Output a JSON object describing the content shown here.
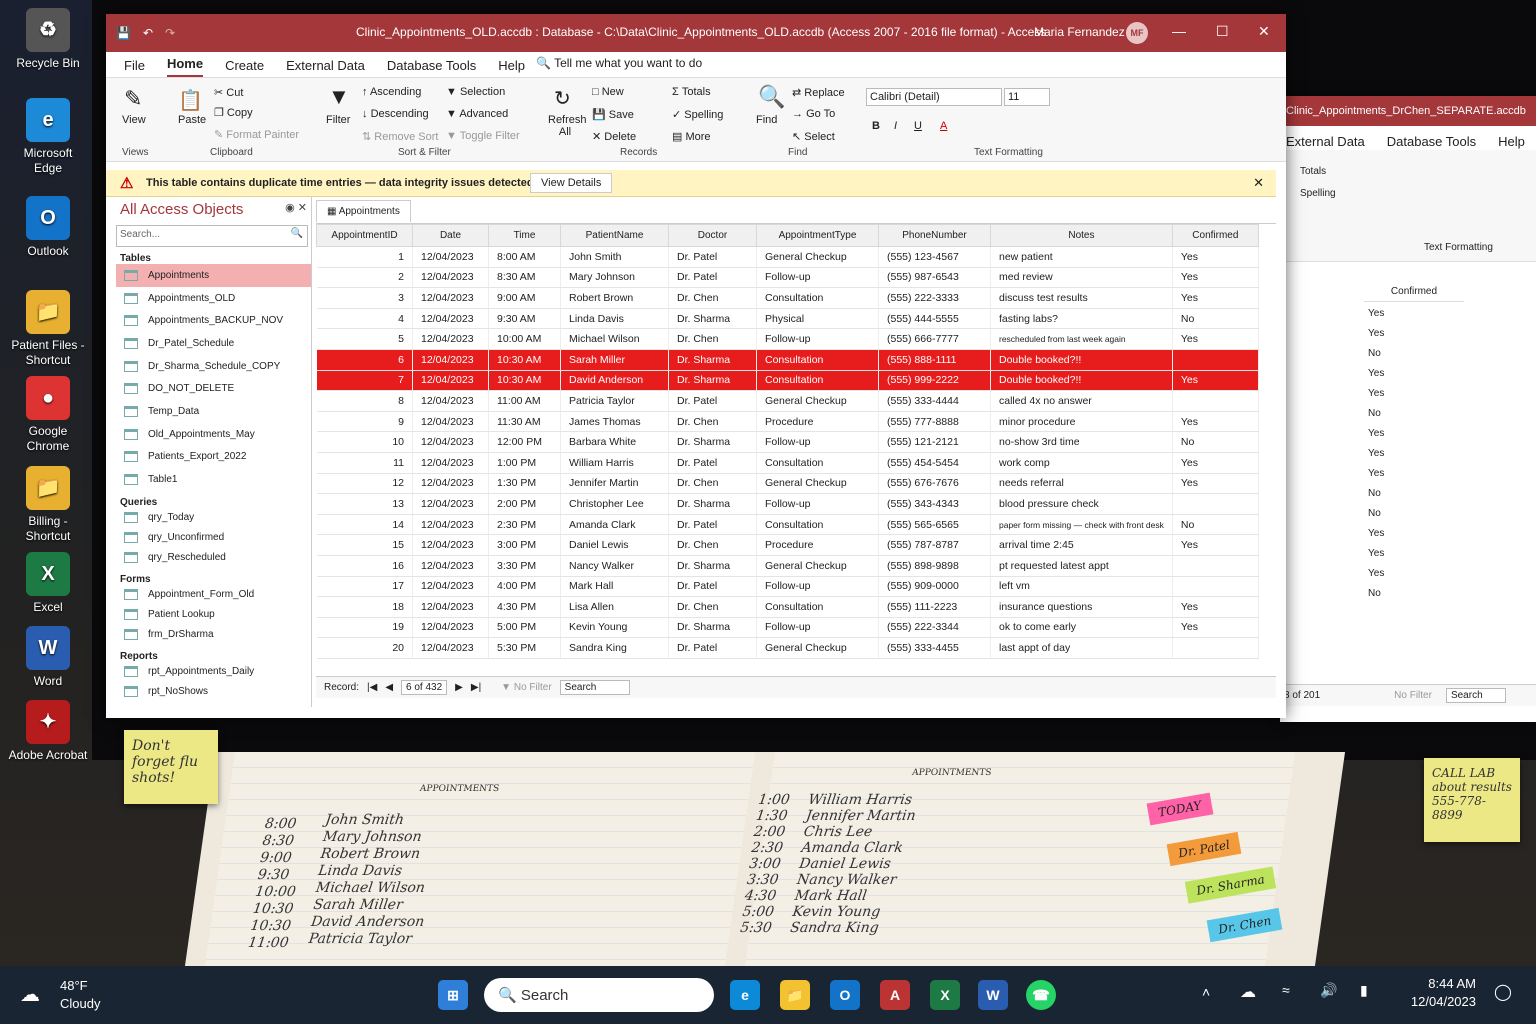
{
  "desktop": {
    "icons": [
      "Recycle Bin",
      "Microsoft Edge",
      "Outlook",
      "Patient Files - Shortcut",
      "Google Chrome",
      "Billing - Shortcut",
      "Excel",
      "Word",
      "Adobe Acrobat"
    ]
  },
  "window": {
    "title": "Clinic_Appointments_OLD.accdb : Database - C:\\Data\\Clinic_Appointments_OLD.accdb (Access 2007 - 2016 file format)  -  Access",
    "user": "Maria Fernandez",
    "initials": "MF"
  },
  "menu": [
    "File",
    "Home",
    "Create",
    "External Data",
    "Database Tools",
    "Help"
  ],
  "tell": "Tell me what you want to do",
  "ribbon": {
    "view": "View",
    "views": "Views",
    "paste": "Paste",
    "cut": "Cut",
    "copy": "Copy",
    "format_painter": "Format Painter",
    "clipboard": "Clipboard",
    "filter": "Filter",
    "ascending": "Ascending",
    "descending": "Descending",
    "remove_sort": "Remove Sort",
    "selection": "Selection",
    "advanced": "Advanced",
    "toggle_filter": "Toggle Filter",
    "sort_filter": "Sort & Filter",
    "refresh": "Refresh All",
    "new": "New",
    "save": "Save",
    "delete": "Delete",
    "totals": "Totals",
    "spelling": "Spelling",
    "more": "More",
    "records": "Records",
    "find": "Find",
    "replace": "Replace",
    "goto": "Go To",
    "select": "Select",
    "find_grp": "Find",
    "font": "Calibri (Detail)",
    "size": "11",
    "text_formatting": "Text Formatting"
  },
  "warning": {
    "text": "This table contains duplicate time entries — data integrity issues detected",
    "button": "View Details"
  },
  "nav": {
    "title": "All Access Objects",
    "search": "Search...",
    "tables_h": "Tables",
    "tables": [
      "Appointments",
      "Appointments_OLD",
      "Appointments_BACKUP_NOV",
      "Dr_Patel_Schedule",
      "Dr_Sharma_Schedule_COPY",
      "DO_NOT_DELETE",
      "Temp_Data",
      "Old_Appointments_May",
      "Patients_Export_2022",
      "Table1"
    ],
    "queries_h": "Queries",
    "queries": [
      "qry_Today",
      "qry_Unconfirmed",
      "qry_Rescheduled"
    ],
    "forms_h": "Forms",
    "forms": [
      "Appointment_Form_Old",
      "Patient Lookup",
      "frm_DrSharma"
    ],
    "reports_h": "Reports",
    "reports": [
      "rpt_Appointments_Daily",
      "rpt_NoShows"
    ]
  },
  "tab": "Appointments",
  "columns": [
    "AppointmentID",
    "Date",
    "Time",
    "PatientName",
    "Doctor",
    "AppointmentType",
    "PhoneNumber",
    "Notes",
    "Confirmed"
  ],
  "rows": [
    [
      "1",
      "12/04/2023",
      "8:00 AM",
      "John Smith",
      "Dr. Patel",
      "General Checkup",
      "(555) 123-4567",
      "new patient",
      "Yes"
    ],
    [
      "2",
      "12/04/2023",
      "8:30 AM",
      "Mary Johnson",
      "Dr. Patel",
      "Follow-up",
      "(555) 987-6543",
      "med review",
      "Yes"
    ],
    [
      "3",
      "12/04/2023",
      "9:00 AM",
      "Robert Brown",
      "Dr. Chen",
      "Consultation",
      "(555) 222-3333",
      "discuss test results",
      "Yes"
    ],
    [
      "4",
      "12/04/2023",
      "9:30 AM",
      "Linda Davis",
      "Dr. Sharma",
      "Physical",
      "(555) 444-5555",
      "fasting labs?",
      "No"
    ],
    [
      "5",
      "12/04/2023",
      "10:00 AM",
      "Michael Wilson",
      "Dr. Chen",
      "Follow-up",
      "(555) 666-7777",
      "rescheduled from last week again",
      "Yes"
    ],
    [
      "6",
      "12/04/2023",
      "10:30 AM",
      "Sarah Miller",
      "Dr. Sharma",
      "Consultation",
      "(555) 888-1111",
      "Double booked?!!",
      ""
    ],
    [
      "7",
      "12/04/2023",
      "10:30 AM",
      "David Anderson",
      "Dr. Sharma",
      "Consultation",
      "(555) 999-2222",
      "Double booked?!!",
      "Yes"
    ],
    [
      "8",
      "12/04/2023",
      "11:00 AM",
      "Patricia Taylor",
      "Dr. Patel",
      "General Checkup",
      "(555) 333-4444",
      "called 4x no answer",
      ""
    ],
    [
      "9",
      "12/04/2023",
      "11:30 AM",
      "James Thomas",
      "Dr. Chen",
      "Procedure",
      "(555) 777-8888",
      "minor procedure",
      "Yes"
    ],
    [
      "10",
      "12/04/2023",
      "12:00 PM",
      "Barbara White",
      "Dr. Sharma",
      "Follow-up",
      "(555) 121-2121",
      "no-show 3rd time",
      "No"
    ],
    [
      "11",
      "12/04/2023",
      "1:00 PM",
      "William Harris",
      "Dr. Patel",
      "Consultation",
      "(555) 454-5454",
      "work comp",
      "Yes"
    ],
    [
      "12",
      "12/04/2023",
      "1:30 PM",
      "Jennifer Martin",
      "Dr. Chen",
      "General Checkup",
      "(555) 676-7676",
      "needs referral",
      "Yes"
    ],
    [
      "13",
      "12/04/2023",
      "2:00 PM",
      "Christopher Lee",
      "Dr. Sharma",
      "Follow-up",
      "(555) 343-4343",
      "blood pressure check",
      ""
    ],
    [
      "14",
      "12/04/2023",
      "2:30 PM",
      "Amanda Clark",
      "Dr. Patel",
      "Consultation",
      "(555) 565-6565",
      "paper form missing — check with front desk",
      "No"
    ],
    [
      "15",
      "12/04/2023",
      "3:00 PM",
      "Daniel Lewis",
      "Dr. Chen",
      "Procedure",
      "(555) 787-8787",
      "arrival time 2:45",
      "Yes"
    ],
    [
      "16",
      "12/04/2023",
      "3:30 PM",
      "Nancy Walker",
      "Dr. Sharma",
      "General Checkup",
      "(555) 898-9898",
      "pt requested latest appt",
      ""
    ],
    [
      "17",
      "12/04/2023",
      "4:00 PM",
      "Mark Hall",
      "Dr. Patel",
      "Follow-up",
      "(555) 909-0000",
      "left vm",
      ""
    ],
    [
      "18",
      "12/04/2023",
      "4:30 PM",
      "Lisa Allen",
      "Dr. Chen",
      "Consultation",
      "(555) 111-2223",
      "insurance questions",
      "Yes"
    ],
    [
      "19",
      "12/04/2023",
      "5:00 PM",
      "Kevin Young",
      "Dr. Sharma",
      "Follow-up",
      "(555) 222-3344",
      "ok to come early",
      "Yes"
    ],
    [
      "20",
      "12/04/2023",
      "5:30 PM",
      "Sandra King",
      "Dr. Patel",
      "General Checkup",
      "(555) 333-4455",
      "last appt of day",
      ""
    ]
  ],
  "record": {
    "label": "Record:",
    "pos": "6 of 432",
    "nofilter": "No Filter",
    "search": "Search"
  },
  "win2": {
    "title": "Clinic_Appointments_DrChen_SEPARATE.accdb",
    "menu": [
      "External Data",
      "Database Tools",
      "Help"
    ],
    "totals": "Totals",
    "spelling": "Spelling",
    "text_formatting": "Text Formatting",
    "col": "Confirmed",
    "vals": [
      "Yes",
      "Yes",
      "No",
      "Yes",
      "Yes",
      "No",
      "Yes",
      "Yes",
      "Yes",
      "No",
      "No",
      "Yes",
      "Yes",
      "Yes",
      "No"
    ],
    "rec": "8 of 201",
    "nofilter": "No Filter",
    "search": "Search"
  },
  "notes": {
    "flu": "Don't forget flu shots!",
    "lab": "CALL LAB about results 555-778-8899",
    "tabs": [
      "TODAY",
      "Dr. Patel",
      "Dr. Sharma",
      "Dr. Chen"
    ],
    "left_times": [
      "8:00",
      "8:30",
      "9:00",
      "9:30",
      "10:00",
      "10:30",
      "10:30",
      "11:00"
    ],
    "left_names": [
      "John Smith",
      "Mary Johnson",
      "Robert Brown",
      "Linda Davis",
      "Michael Wilson",
      "Sarah Miller",
      "David Anderson",
      "Patricia Taylor"
    ],
    "right_times": [
      "1:00",
      "1:30",
      "2:00",
      "2:30",
      "3:00",
      "3:30",
      "4:30",
      "5:00",
      "5:30"
    ],
    "right_names": [
      "William Harris",
      "Jennifer Martin",
      "Chris Lee",
      "Amanda Clark",
      "Daniel Lewis",
      "Nancy Walker",
      "Mark Hall",
      "Kevin Young",
      "Sandra King"
    ],
    "header": "APPOINTMENTS"
  },
  "taskbar": {
    "temp": "48°F",
    "weather": "Cloudy",
    "search": "Search",
    "time": "8:44 AM",
    "date": "12/04/2023"
  }
}
